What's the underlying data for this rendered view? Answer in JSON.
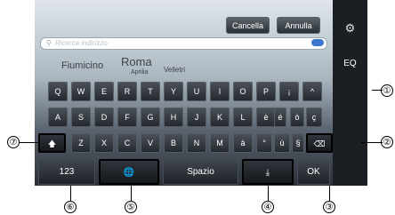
{
  "topbar": {
    "cancel": "Cancella",
    "annulla": "Annulla"
  },
  "search": {
    "placeholder": "Ricerca indirizzo"
  },
  "map": {
    "place1": "Fiumicino",
    "place2": "Roma",
    "place3": "Velletri",
    "place4": "Aprilia"
  },
  "keys": {
    "row1": [
      "Q",
      "W",
      "E",
      "R",
      "T",
      "Y",
      "U",
      "I",
      "O",
      "P",
      "¡",
      "^"
    ],
    "row2": [
      "A",
      "S",
      "D",
      "F",
      "G",
      "H",
      "J",
      "K",
      "L",
      "è",
      "é",
      "ò",
      "ç"
    ],
    "row3": [
      "Z",
      "X",
      "C",
      "V",
      "B",
      "N",
      "M",
      "à",
      "°",
      "ù",
      "§"
    ]
  },
  "bottom": {
    "num": "123",
    "space": "Spazio",
    "ok": "OK"
  },
  "side": {
    "eq": "EQ"
  },
  "callouts": [
    "①",
    "②",
    "③",
    "④",
    "⑤",
    "⑥",
    "⑦"
  ]
}
